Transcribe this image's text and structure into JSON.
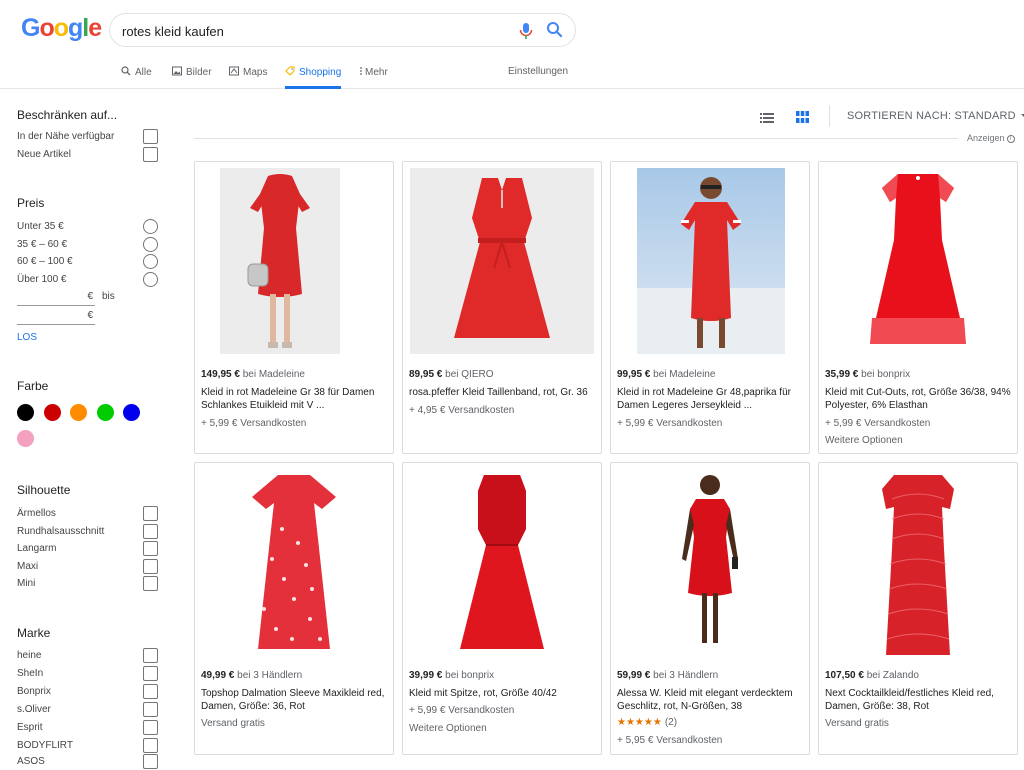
{
  "header": {
    "logo": [
      "G",
      "o",
      "o",
      "g",
      "l",
      "e"
    ],
    "query": "rotes kleid kaufen",
    "tabs": [
      {
        "label": "Alle",
        "icon": "search-icon"
      },
      {
        "label": "Bilder",
        "icon": "image-icon"
      },
      {
        "label": "Maps",
        "icon": "map-icon"
      },
      {
        "label": "Shopping",
        "icon": "tag-icon",
        "active": true
      },
      {
        "label": "Mehr",
        "icon": "more-vert-icon"
      }
    ],
    "settings": "Einstellungen"
  },
  "sidebar": {
    "restrict": {
      "title": "Beschränken auf...",
      "items": [
        "In der Nähe verfügbar",
        "Neue Artikel"
      ]
    },
    "price": {
      "title": "Preis",
      "items": [
        "Unter 35 €",
        "35 € – 60 €",
        "60 € – 100 €",
        "Über 100 €"
      ],
      "currency": "€",
      "bis": "bis",
      "go": "LOS"
    },
    "color": {
      "title": "Farbe",
      "swatches": [
        {
          "name": "black",
          "hex": "#000000"
        },
        {
          "name": "red",
          "hex": "#cc0000"
        },
        {
          "name": "orange",
          "hex": "#ff8c00"
        },
        {
          "name": "green",
          "hex": "#00cc00"
        },
        {
          "name": "blue",
          "hex": "#0000ee"
        },
        {
          "name": "pink",
          "hex": "#f4a0c0"
        }
      ]
    },
    "silhouette": {
      "title": "Silhouette",
      "items": [
        "Ärmellos",
        "Rundhalsausschnitt",
        "Langarm",
        "Maxi",
        "Mini"
      ]
    },
    "brand": {
      "title": "Marke",
      "items": [
        "heine",
        "SheIn",
        "Bonprix",
        "s.Oliver",
        "Esprit",
        "BODYFLIRT",
        "ASOS"
      ]
    }
  },
  "toolbar": {
    "sort_label": "SORTIEREN NACH: STANDARD",
    "ads_label": "Anzeigen",
    "info": "i"
  },
  "products": [
    {
      "price": "149,95 €",
      "shop": "bei Madeleine",
      "title": "Kleid in rot Madeleine Gr 38 für Damen Schlankes Etuikleid mit V ...",
      "shipping": "+ 5,99 € Versandkosten",
      "extra": ""
    },
    {
      "price": "89,95 €",
      "shop": "bei QIERO",
      "title": "rosa.pfeffer Kleid Taillenband, rot, Gr. 36",
      "shipping": "+ 4,95 € Versandkosten",
      "extra": ""
    },
    {
      "price": "99,95 €",
      "shop": "bei Madeleine",
      "title": "Kleid in rot Madeleine Gr 48,paprika für Damen Legeres Jerseykleid ...",
      "shipping": "+ 5,99 € Versandkosten",
      "extra": ""
    },
    {
      "price": "35,99 €",
      "shop": "bei bonprix",
      "title": "Kleid mit Cut-Outs, rot, Größe 36/38, 94% Polyester, 6% Elasthan",
      "shipping": "+ 5,99 € Versandkosten",
      "extra": "Weitere Optionen"
    },
    {
      "price": "49,99 €",
      "shop": "bei 3 Händlern",
      "title": "Topshop Dalmation Sleeve Maxikleid red, Damen, Größe: 36, Rot",
      "shipping": "Versand gratis",
      "extra": ""
    },
    {
      "price": "39,99 €",
      "shop": "bei bonprix",
      "title": "Kleid mit Spitze, rot, Größe 40/42",
      "shipping": "+ 5,99 € Versandkosten",
      "extra": "Weitere Optionen"
    },
    {
      "price": "59,99 €",
      "shop": "bei 3 Händlern",
      "title": "Alessa W. Kleid mit elegant verdecktem Geschlitz, rot, N-Größen, 38",
      "stars": "★★★★★",
      "rating_count": "(2)",
      "shipping": "+ 5,95 € Versandkosten",
      "extra": ""
    },
    {
      "price": "107,50 €",
      "shop": "bei Zalando",
      "title": "Next Cocktailkleid/festliches Kleid red, Damen, Größe: 38, Rot",
      "shipping": "Versand gratis",
      "extra": ""
    }
  ]
}
